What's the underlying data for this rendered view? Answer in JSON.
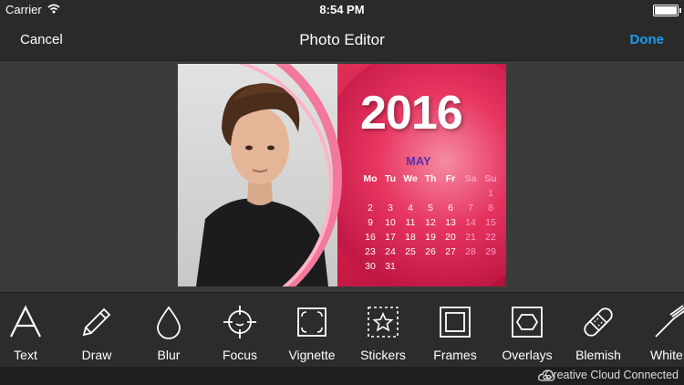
{
  "status_bar": {
    "carrier": "Carrier",
    "time": "8:54 PM"
  },
  "nav": {
    "cancel": "Cancel",
    "title": "Photo Editor",
    "done": "Done",
    "accent_color": "#1e9bf0"
  },
  "photo": {
    "year": "2016",
    "month": "MAY",
    "weekdays": [
      "Mo",
      "Tu",
      "We",
      "Th",
      "Fr",
      "Sa",
      "Su"
    ],
    "weeks": [
      [
        "",
        "",
        "",
        "",
        "",
        "",
        "1"
      ],
      [
        "2",
        "3",
        "4",
        "5",
        "6",
        "7",
        "8"
      ],
      [
        "9",
        "10",
        "11",
        "12",
        "13",
        "14",
        "15"
      ],
      [
        "16",
        "17",
        "18",
        "19",
        "20",
        "21",
        "22"
      ],
      [
        "23",
        "24",
        "25",
        "26",
        "27",
        "28",
        "29"
      ],
      [
        "30",
        "31",
        "",
        "",
        "",
        "",
        ""
      ]
    ]
  },
  "tools": [
    {
      "label": "Text",
      "icon": "text-icon"
    },
    {
      "label": "Draw",
      "icon": "pencil-icon"
    },
    {
      "label": "Blur",
      "icon": "drop-icon"
    },
    {
      "label": "Focus",
      "icon": "crosshair-icon"
    },
    {
      "label": "Vignette",
      "icon": "vignette-icon"
    },
    {
      "label": "Stickers",
      "icon": "star-icon"
    },
    {
      "label": "Frames",
      "icon": "frame-icon"
    },
    {
      "label": "Overlays",
      "icon": "hexagon-icon"
    },
    {
      "label": "Blemish",
      "icon": "bandage-icon"
    },
    {
      "label": "White",
      "icon": "brush-icon"
    }
  ],
  "footer": {
    "text": "Creative Cloud Connected"
  }
}
